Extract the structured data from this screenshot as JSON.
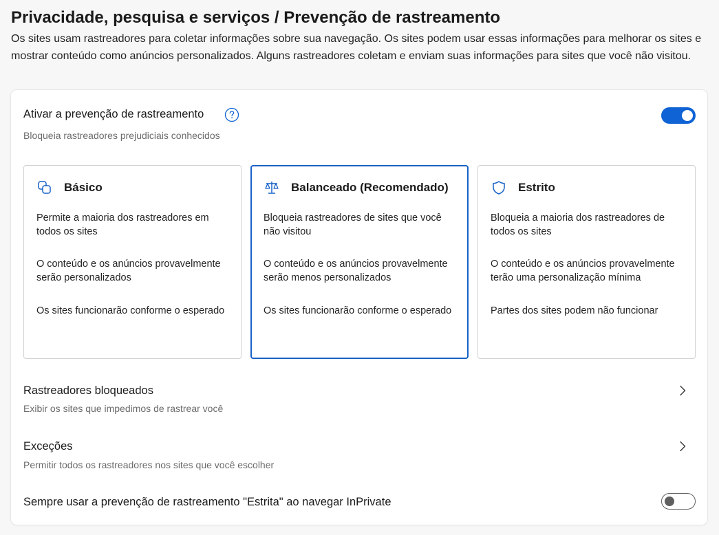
{
  "header": {
    "title": "Privacidade, pesquisa e serviços / Prevenção de rastreamento",
    "description": "Os sites usam rastreadores para coletar informações sobre sua navegação. Os sites podem usar essas informações para melhorar os sites e mostrar conteúdo como anúncios personalizados. Alguns rastreadores coletam e enviam suas informações para sites que você não visitou."
  },
  "tracking": {
    "title": "Ativar a prevenção de rastreamento",
    "subtitle": "Bloqueia rastreadores prejudiciais conhecidos",
    "enabled": true,
    "help_icon": "help-circle-icon",
    "accent_color": "#0f63d4"
  },
  "levels": [
    {
      "title": "Básico",
      "icon": "layers-icon",
      "selected": false,
      "lines": [
        "Permite a maioria dos rastreadores em todos os sites",
        "O conteúdo e os anúncios provavelmente serão personalizados",
        "Os sites funcionarão conforme o esperado"
      ]
    },
    {
      "title": "Balanceado (Recomendado)",
      "icon": "balance-scale-icon",
      "selected": true,
      "lines": [
        "Bloqueia rastreadores de sites que você não visitou",
        "O conteúdo e os anúncios provavelmente serão menos personalizados",
        "Os sites funcionarão conforme o esperado"
      ]
    },
    {
      "title": "Estrito",
      "icon": "shield-icon",
      "selected": false,
      "lines": [
        "Bloqueia a maioria dos rastreadores de todos os sites",
        "O conteúdo e os anúncios provavelmente terão uma personalização mínima",
        "Partes dos sites podem não funcionar"
      ]
    }
  ],
  "blocked": {
    "title": "Rastreadores bloqueados",
    "subtitle": "Exibir os sites que impedimos de rastrear você"
  },
  "exceptions": {
    "title": "Exceções",
    "subtitle": "Permitir todos os rastreadores nos sites que você escolher"
  },
  "inprivate": {
    "title": "Sempre usar a prevenção de rastreamento \"Estrita\" ao navegar InPrivate",
    "enabled": false
  }
}
